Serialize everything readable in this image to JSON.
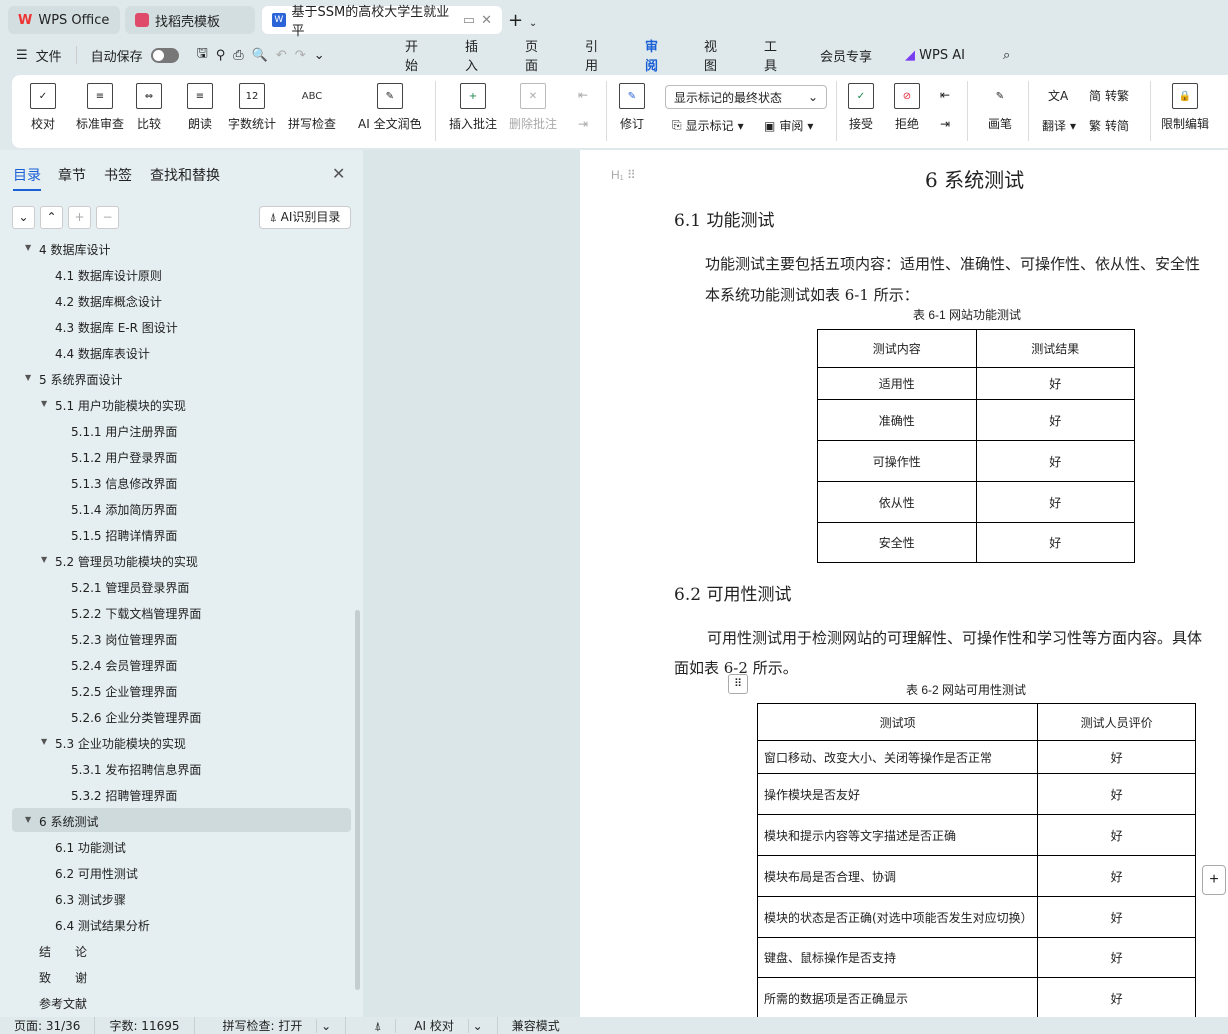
{
  "tabs": [
    {
      "label": "WPS Office"
    },
    {
      "label": "找稻壳模板"
    },
    {
      "label": "基于SSM的高校大学生就业平"
    }
  ],
  "menu": {
    "file": "文件",
    "autosave": "自动保存",
    "items": [
      "开始",
      "插入",
      "页面",
      "引用",
      "审阅",
      "视图",
      "工具",
      "会员专享",
      "WPS AI"
    ],
    "active": "审阅"
  },
  "ribbon": {
    "buttons": [
      "校对",
      "标准审查",
      "比较",
      "朗读",
      "字数统计",
      "拼写检查",
      "AI 全文润色",
      "插入批注",
      "删除批注",
      "修订",
      "接受",
      "拒绝",
      "画笔",
      "限制编辑"
    ],
    "markup_select": "显示标记的最终状态",
    "show_markup": "显示标记",
    "review": "审阅",
    "translate": "翻译",
    "to_trad": "转繁",
    "to_simp": "转简"
  },
  "sidebar": {
    "tabs": [
      "目录",
      "章节",
      "书签",
      "查找和替换"
    ],
    "ai_button": "AI识别目录",
    "items": [
      {
        "label": "4 数据库设计",
        "level": 1,
        "expanded": true
      },
      {
        "label": "4.1 数据库设计原则",
        "level": 2
      },
      {
        "label": "4.2 数据库概念设计",
        "level": 2
      },
      {
        "label": "4.3 数据库 E-R 图设计",
        "level": 2
      },
      {
        "label": "4.4 数据库表设计",
        "level": 2
      },
      {
        "label": "5 系统界面设计",
        "level": 1,
        "expanded": true
      },
      {
        "label": "5.1 用户功能模块的实现",
        "level": 2,
        "expanded": true
      },
      {
        "label": "5.1.1  用户注册界面",
        "level": 3
      },
      {
        "label": "5.1.2 用户登录界面",
        "level": 3
      },
      {
        "label": "5.1.3 信息修改界面",
        "level": 3
      },
      {
        "label": "5.1.4 添加简历界面",
        "level": 3
      },
      {
        "label": "5.1.5 招聘详情界面",
        "level": 3
      },
      {
        "label": "5.2 管理员功能模块的实现",
        "level": 2,
        "expanded": true
      },
      {
        "label": "5.2.1 管理员登录界面",
        "level": 3
      },
      {
        "label": "5.2.2 下载文档管理界面",
        "level": 3
      },
      {
        "label": "5.2.3 岗位管理界面",
        "level": 3
      },
      {
        "label": "5.2.4 会员管理界面",
        "level": 3
      },
      {
        "label": "5.2.5 企业管理界面",
        "level": 3
      },
      {
        "label": "5.2.6 企业分类管理界面",
        "level": 3
      },
      {
        "label": "5.3 企业功能模块的实现",
        "level": 2,
        "expanded": true
      },
      {
        "label": "5.3.1 发布招聘信息界面",
        "level": 3
      },
      {
        "label": "5.3.2 招聘管理界面",
        "level": 3
      },
      {
        "label": "6 系统测试",
        "level": 1,
        "expanded": true,
        "selected": true
      },
      {
        "label": "6.1 功能测试",
        "level": 2
      },
      {
        "label": "6.2 可用性测试",
        "level": 2
      },
      {
        "label": "6.3 测试步骤",
        "level": 2
      },
      {
        "label": "6.4 测试结果分析",
        "level": 2
      },
      {
        "label": "结　　论",
        "level": 1
      },
      {
        "label": "致　　谢",
        "level": 1
      },
      {
        "label": "参考文献",
        "level": 1
      }
    ]
  },
  "document": {
    "h1": "6 系统测试",
    "h2a": "6.1 功能测试",
    "p1a": "功能测试主要包括五项内容：适用性、准确性、可操作性、依从性、安全性",
    "p1b": "本系统功能测试如表 6-1 所示：",
    "t1caption": "表 6-1  网站功能测试",
    "t1": [
      [
        "测试内容",
        "测试结果"
      ],
      [
        "适用性",
        "好"
      ],
      [
        "准确性",
        "好"
      ],
      [
        "可操作性",
        "好"
      ],
      [
        "依从性",
        "好"
      ],
      [
        "安全性",
        "好"
      ]
    ],
    "h2b": "6.2 可用性测试",
    "p2a": "可用性测试用于检测网站的可理解性、可操作性和学习性等方面内容。具体",
    "p2b": "面如表 6-2 所示。",
    "t2caption": "表 6-2  网站可用性测试",
    "t2": [
      [
        "测试项",
        "测试人员评价"
      ],
      [
        "窗口移动、改变大小、关闭等操作是否正常",
        "好"
      ],
      [
        "操作模块是否友好",
        "好"
      ],
      [
        "模块和提示内容等文字描述是否正确",
        "好"
      ],
      [
        "模块布局是否合理、协调",
        "好"
      ],
      [
        "模块的状态是否正确(对选中项能否发生对应切换）",
        "好"
      ],
      [
        "键盘、鼠标操作是否支持",
        "好"
      ],
      [
        "所需的数据项是否正确显示",
        "好"
      ]
    ]
  },
  "status": {
    "page": "页面: 31/36",
    "words": "字数: 11695",
    "spell": "拼写检查: 打开",
    "ai": "AI 校对",
    "compat": "兼容模式"
  },
  "colors": {
    "accent": "#1a5fd6",
    "wps_red": "#e33"
  }
}
